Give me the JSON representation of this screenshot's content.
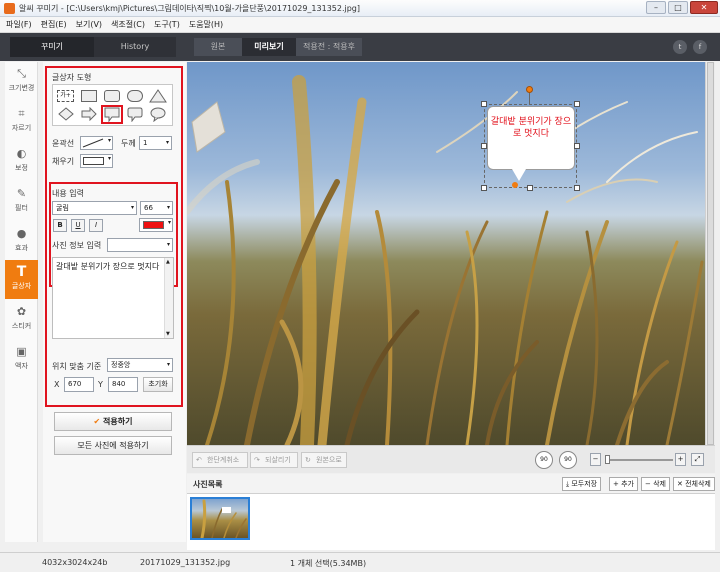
{
  "window": {
    "title": "알씨 꾸미기 - [C:\\Users\\kmj\\Pictures\\그림데이타\\직찍\\10월-가을단풍\\20171029_131352.jpg]",
    "minimize": "–",
    "maximize": "□",
    "close": "✕"
  },
  "menu": [
    "파일(F)",
    "편집(E)",
    "보기(V)",
    "색조절(C)",
    "도구(T)",
    "도움말(H)"
  ],
  "topbar": {
    "tab_decorate": "꾸미기",
    "tab_history": "History",
    "view_original": "원본",
    "view_preview": "미리보기",
    "view_before_after": "적용전 : 적용후",
    "twitter": "t",
    "facebook": "f"
  },
  "tools": [
    {
      "icon": "resize-icon",
      "label": "크기변경",
      "glyph": "⤡"
    },
    {
      "icon": "crop-icon",
      "label": "자르기",
      "glyph": "⌗"
    },
    {
      "icon": "correction-icon",
      "label": "보정",
      "glyph": "◐"
    },
    {
      "icon": "filter-icon",
      "label": "필터",
      "glyph": "✎"
    },
    {
      "icon": "effect-icon",
      "label": "효과",
      "glyph": "●"
    },
    {
      "icon": "text-icon",
      "label": "글상자",
      "glyph": "T"
    },
    {
      "icon": "sticker-icon",
      "label": "스티커",
      "glyph": "✿"
    },
    {
      "icon": "frame-icon",
      "label": "액자",
      "glyph": "▣"
    }
  ],
  "panel": {
    "shapes_title": "글상자 도형",
    "text_shape_label": "가+",
    "outline_label": "윤곽선",
    "thickness_label": "두께",
    "thickness_value": "1",
    "fill_label": "채우기",
    "content_title": "내용 입력",
    "font_value": "굴림",
    "font_size_value": "66",
    "bold": "B",
    "underline": "U",
    "italic": "I",
    "text_color": "#ee1111",
    "photo_info_label": "사진 정보 입력",
    "text_content": "갈대밭 분위기가 장으로 멋지다",
    "position_label": "위치 맞춤 기준",
    "position_value": "정중앙",
    "x_label": "X",
    "x_value": "670",
    "y_label": "Y",
    "y_value": "840",
    "reset_button": "초기화",
    "apply_button": "적용하기",
    "apply_all_button": "모든 사진에 적용하기"
  },
  "canvas": {
    "speech_text": "갈대밭 분위기가 장으로 멋지다"
  },
  "canvas_toolbar": {
    "undo": "한단계취소",
    "redo": "되살리기",
    "original": "원본으로",
    "rotate_left": "90",
    "rotate_right": "90",
    "zoom_out": "−",
    "zoom_in": "+"
  },
  "photo_list": {
    "title": "사진목록",
    "save_all": "모두저장",
    "add": "+ 추가",
    "delete": "− 삭제",
    "delete_all": "✕ 전체삭제"
  },
  "status": {
    "dimensions": "4032x3024x24b",
    "filename": "20171029_131352.jpg",
    "selection": "1 개체 선택(5.34MB)"
  },
  "colors": {
    "accent": "#f07c10",
    "highlight_box": "#e0141f"
  }
}
